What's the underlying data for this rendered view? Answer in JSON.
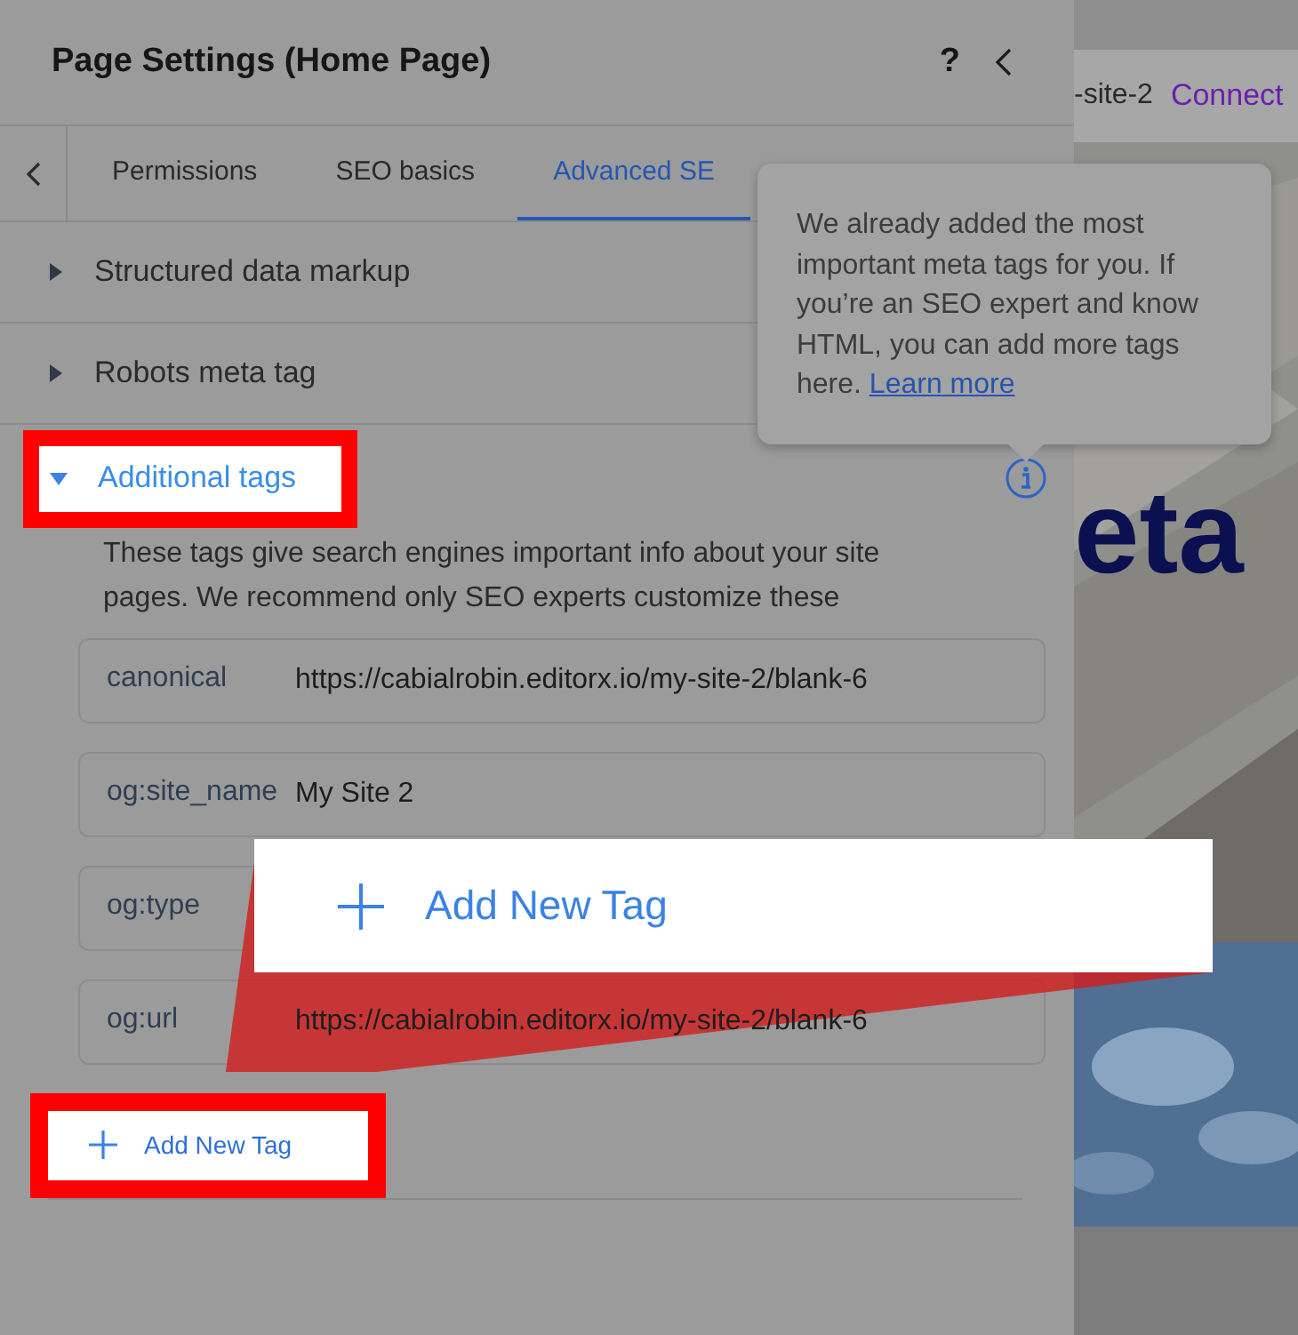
{
  "panel": {
    "title": "Page Settings (Home Page)",
    "help": "?",
    "tabs": [
      {
        "label": "Permissions",
        "selected": false
      },
      {
        "label": "SEO basics",
        "selected": false
      },
      {
        "label": "Advanced SE",
        "selected": true
      }
    ],
    "sections": [
      {
        "label": "Structured data markup",
        "expanded": false,
        "highlighted": false
      },
      {
        "label": "Robots meta tag",
        "expanded": false,
        "highlighted": false
      },
      {
        "label": "Additional tags",
        "expanded": true,
        "highlighted": true,
        "description": "These tags give search engines important info about your site pages. We recommend only SEO experts customize these",
        "tags": [
          {
            "name": "canonical",
            "value": "https://cabialrobin.editorx.io/my-site-2/blank-6"
          },
          {
            "name": "og:site_name",
            "value": "My Site 2"
          },
          {
            "name": "og:type"
          },
          {
            "name": "og:url",
            "value": "https://cabialrobin.editorx.io/my-site-2/blank-6"
          }
        ],
        "add_button": {
          "label": "Add New Tag",
          "highlighted": true
        }
      }
    ]
  },
  "tooltip": {
    "text": "We already added the most important meta tags for you. If you’re an SEO expert and know HTML, you can add more tags here.",
    "link": "Learn more"
  },
  "preview": {
    "url": "-site-2",
    "connect": "Connect",
    "heading": "eta"
  },
  "callout": {
    "label": "Add New Tag"
  }
}
